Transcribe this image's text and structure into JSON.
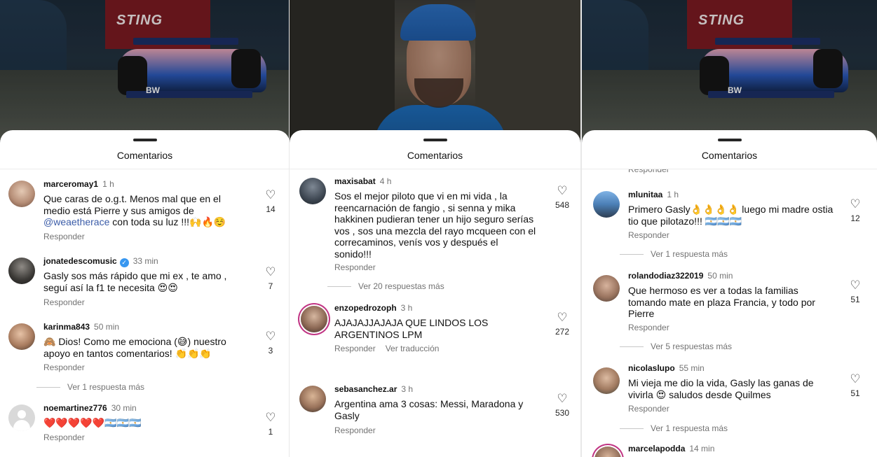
{
  "sheet_title": "Comentarios",
  "reply_label": "Responder",
  "see_translation": "Ver traducción",
  "photos": {
    "barrier_text": "STING",
    "car_logo": "BW"
  },
  "panel1": {
    "comments": [
      {
        "user": "marceromay1",
        "time": "1 h",
        "text_before": "Que caras de o.g.t. Menos mal que en el medio está Pierre y sus amigos de ",
        "mention": "@weaetherace",
        "text_after": " con toda su luz !!!🙌🔥☺️",
        "likes": "14"
      },
      {
        "user": "jonatedescomusic",
        "time": "33 min",
        "verified": "✓",
        "text": "Gasly sos más rápido que mi ex , te amo , seguí así la f1 te necesita 😍😍",
        "likes": "7"
      },
      {
        "user": "karinma843",
        "time": "50 min",
        "text": "🙈 Dios! Como me emociona (😅) nuestro apoyo en tantos comentarios! 👏👏👏",
        "likes": "3",
        "more": "Ver 1 respuesta más"
      },
      {
        "user": "noemartinez776",
        "time": "30 min",
        "text": "❤️❤️❤️❤️❤️🇦🇷🇦🇷🇦🇷",
        "likes": "1"
      }
    ]
  },
  "panel2": {
    "comments": [
      {
        "user": "maxisabat",
        "time": "4 h",
        "text": "Sos el mejor piloto que vi en mi vida , la reencarnación de fangio , si senna y mika hakkinen pudieran tener un hijo seguro serías vos , sos una mezcla del rayo mcqueen con el correcaminos, venís vos y después el sonido!!!",
        "likes": "548",
        "more": "Ver 20 respuestas más"
      },
      {
        "user": "enzopedrozoph",
        "time": "3 h",
        "text": "AJAJAJJAJAJA QUE LINDOS LOS ARGENTINOS LPM",
        "likes": "272"
      },
      {
        "user": "sebasanchez.ar",
        "time": "3 h",
        "text": "Argentina ama 3 cosas: Messi, Maradona y Gasly",
        "likes": "530"
      }
    ]
  },
  "panel3": {
    "comments": [
      {
        "user": "mlunitaa",
        "time": "1 h",
        "text": "Primero Gasly👌👌👌👌 luego mi madre ostia tio que pilotazo!!! 🇦🇷🇦🇷🇦🇷",
        "likes": "12",
        "more": "Ver 1 respuesta más"
      },
      {
        "user": "rolandodiaz322019",
        "time": "50 min",
        "text": "Que hermoso es ver a todas la familias tomando mate en plaza Francia, y todo por Pierre",
        "likes": "51",
        "more": "Ver 5 respuestas más"
      },
      {
        "user": "nicolaslupo",
        "time": "55 min",
        "text": "Mi vieja me dio la vida, Gasly las ganas de vivirla 😍 saludos desde Quilmes",
        "likes": "51",
        "more": "Ver 1 respuesta más"
      },
      {
        "user": "marcelapodda",
        "time": "14 min"
      }
    ]
  }
}
